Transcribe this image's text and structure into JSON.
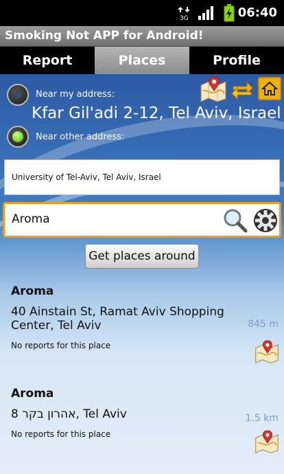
{
  "status": {
    "network": "3G",
    "time": "06:40"
  },
  "app": {
    "title": "Smoking Not APP for Android!"
  },
  "tabs": [
    {
      "label": "Report"
    },
    {
      "label": "Places"
    },
    {
      "label": "Profile"
    }
  ],
  "location": {
    "near_my_address_label": "Near my address:",
    "my_address": "Kfar Gil'adi 2-12, Tel Aviv, Israel",
    "near_other_address_label": "Near other address:",
    "other_address_value": "University of Tel-Aviv, Tel Aviv, Israel",
    "selected": "other"
  },
  "search": {
    "value": "Aroma"
  },
  "actions": {
    "get_places_label": "Get places around"
  },
  "places": [
    {
      "name": "Aroma",
      "address": "40 Ainstain St, Ramat Aviv Shopping Center, Tel Aviv",
      "reports": "No reports for this place",
      "distance": "845 m"
    },
    {
      "name": "Aroma",
      "address": "אהרון בקר 8, Tel Aviv",
      "reports": "No reports for this place",
      "distance": "1.5 km"
    }
  ],
  "colors": {
    "accent": "#f39c12",
    "home": "#f4b000",
    "selected_radio": "#4fb800"
  },
  "icons": [
    "map-icon",
    "refresh-icon",
    "home-icon",
    "search-icon",
    "settings-icon"
  ]
}
